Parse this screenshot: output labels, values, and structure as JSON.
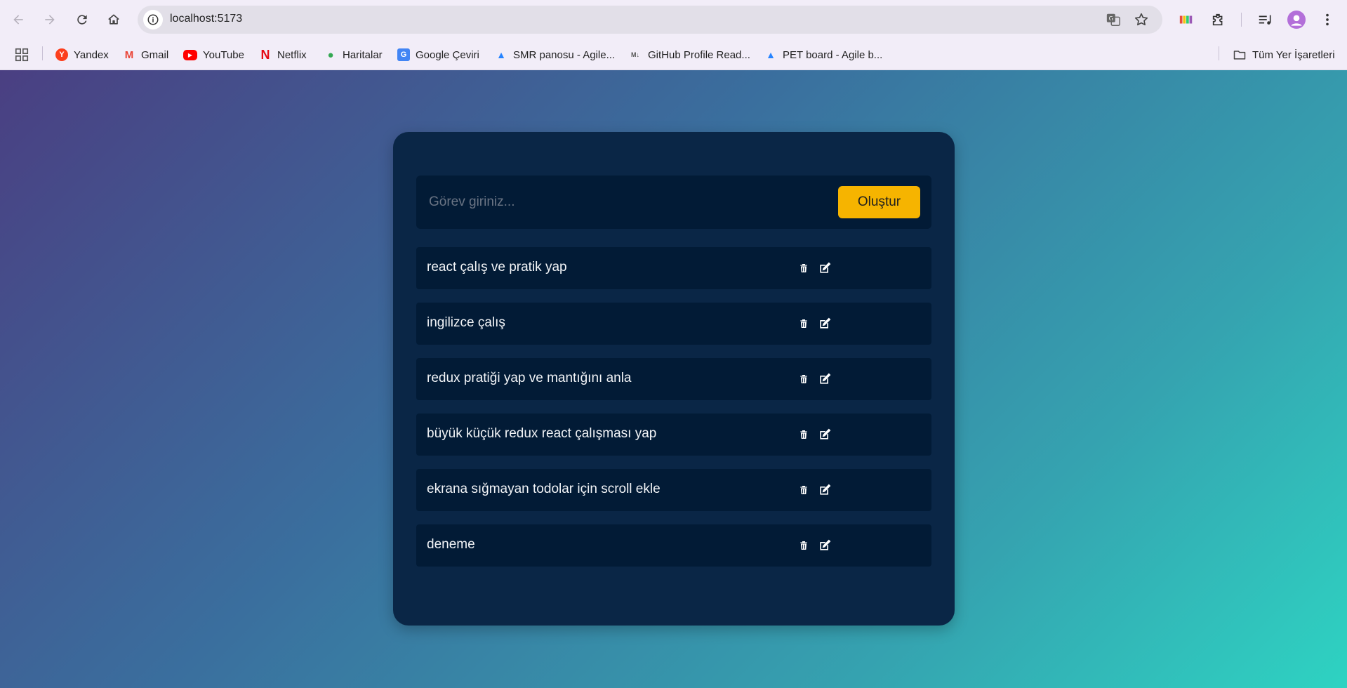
{
  "browser": {
    "url": "localhost:5173",
    "bookmarks": [
      {
        "label": "Yandex",
        "icon": "yandex-icon",
        "color": "#fc3f1d",
        "glyph": "Y"
      },
      {
        "label": "Gmail",
        "icon": "gmail-icon",
        "color": "#ea4335",
        "glyph": "M"
      },
      {
        "label": "YouTube",
        "icon": "youtube-icon",
        "color": "#ff0000",
        "glyph": "▶"
      },
      {
        "label": "Netflix",
        "icon": "netflix-icon",
        "color": "#e50914",
        "glyph": "N"
      },
      {
        "label": "Haritalar",
        "icon": "maps-icon",
        "color": "#34a853",
        "glyph": "●"
      },
      {
        "label": "Google Çeviri",
        "icon": "translate-icon",
        "color": "#4285f4",
        "glyph": "G"
      },
      {
        "label": "SMR panosu - Agile...",
        "icon": "atlassian-icon",
        "color": "#2684ff",
        "glyph": "▲"
      },
      {
        "label": "GitHub Profile Read...",
        "icon": "readme-icon",
        "color": "#555555",
        "glyph": "M↓"
      },
      {
        "label": "PET board - Agile b...",
        "icon": "atlassian-icon",
        "color": "#2684ff",
        "glyph": "▲"
      }
    ],
    "all_bookmarks": "Tüm Yer İşaretleri"
  },
  "app": {
    "input_placeholder": "Görev giriniz...",
    "input_value": "",
    "create_label": "Oluştur",
    "todos": [
      {
        "text": "react çalış ve pratik yap"
      },
      {
        "text": "ingilizce çalış"
      },
      {
        "text": "redux pratiği yap ve mantığını anla"
      },
      {
        "text": "büyük küçük redux react çalışması yap"
      },
      {
        "text": "ekrana sığmayan todolar için scroll ekle"
      },
      {
        "text": "deneme"
      }
    ]
  },
  "colors": {
    "card": "#0a2646",
    "item": "#021b36",
    "accent": "#f6b400"
  }
}
